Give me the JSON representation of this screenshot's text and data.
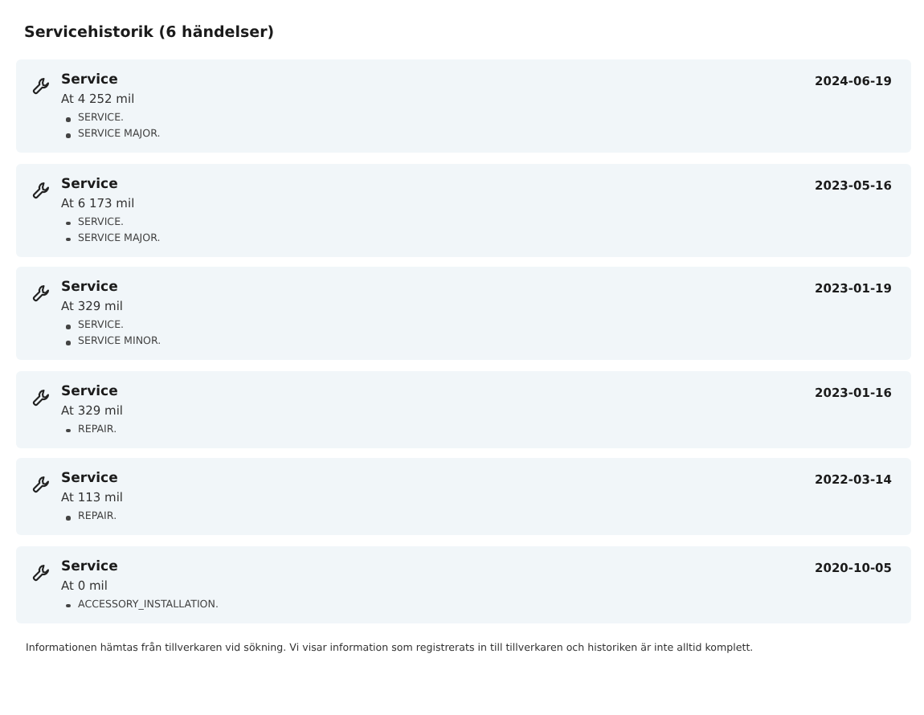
{
  "heading": "Servicehistorik (6 händelser)",
  "events": [
    {
      "title": "Service",
      "mileage": "At 4 252 mil",
      "date": "2024-06-19",
      "items": [
        "SERVICE.",
        "SERVICE MAJOR."
      ]
    },
    {
      "title": "Service",
      "mileage": "At 6 173 mil",
      "date": "2023-05-16",
      "items": [
        "SERVICE.",
        "SERVICE MAJOR."
      ]
    },
    {
      "title": "Service",
      "mileage": "At 329 mil",
      "date": "2023-01-19",
      "items": [
        "SERVICE.",
        "SERVICE MINOR."
      ]
    },
    {
      "title": "Service",
      "mileage": "At 329 mil",
      "date": "2023-01-16",
      "items": [
        "REPAIR."
      ]
    },
    {
      "title": "Service",
      "mileage": "At 113 mil",
      "date": "2022-03-14",
      "items": [
        "REPAIR."
      ]
    },
    {
      "title": "Service",
      "mileage": "At 0 mil",
      "date": "2020-10-05",
      "items": [
        "ACCESSORY_INSTALLATION."
      ]
    }
  ],
  "footer": "Informationen hämtas från tillverkaren vid sökning. Vi visar information som registrerats in till tillverkaren och historiken är inte alltid komplett."
}
